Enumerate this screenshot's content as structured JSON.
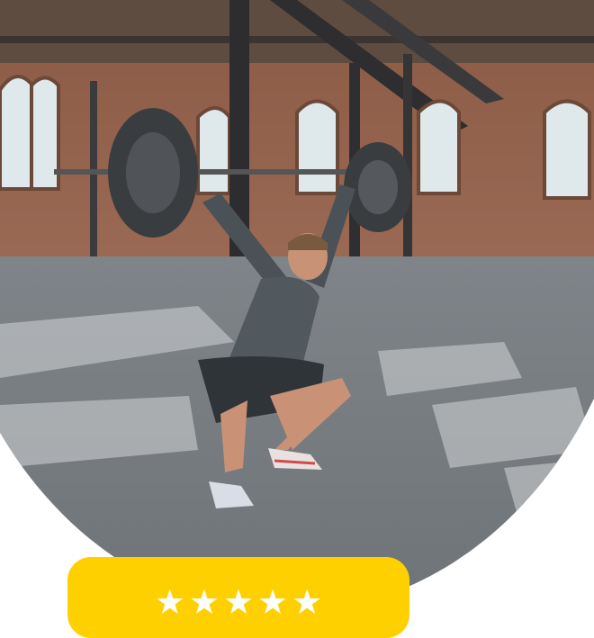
{
  "photo": {
    "subject": "athlete-overhead-squat-barbell"
  },
  "rating": {
    "stars": 5,
    "max": 5,
    "color": "#FFD000",
    "star_glyph": "★"
  }
}
